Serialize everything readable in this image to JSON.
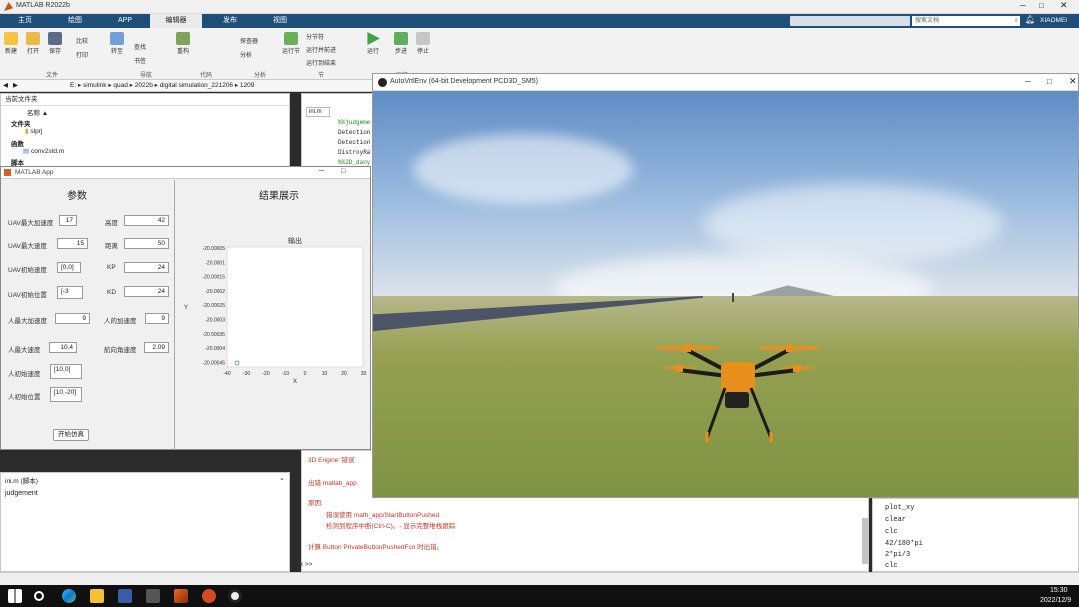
{
  "title": {
    "app": "MATLAB R2022b"
  },
  "tabs": [
    "主页",
    "绘图",
    "APP",
    "编辑器",
    "发布",
    "视图"
  ],
  "search_placeholder": "搜索文档",
  "user": "XIAOMEI",
  "ribbon": {
    "new": "新建",
    "open": "打开",
    "save": "保存",
    "compare": "比较",
    "print": "打印",
    "goto": "转至",
    "find": "查找",
    "bookmark": "书签",
    "refactor": "重构",
    "profiler": "探查器",
    "analyze": "分析",
    "section": "分节符",
    "run_section": "运行节",
    "run_advance": "运行并前进",
    "run_end": "运行到结束",
    "run": "运行",
    "step": "步进",
    "stop": "停止",
    "groups": [
      "文件",
      "导航",
      "代码",
      "分析",
      "节",
      "运行"
    ]
  },
  "address": [
    "E:",
    "simulink",
    "quad",
    "2022b",
    "digital simulation_221206",
    "1209"
  ],
  "current_folder": {
    "title": "当前文件夹",
    "name_col": "名称 ▲",
    "groups": [
      "文件夹",
      "函数",
      "脚本"
    ],
    "items": [
      "slprj",
      "conv2std.m"
    ]
  },
  "editor": {
    "tab": "ini.m",
    "lines": [
      "%%judgeme",
      "Detection",
      "Detection",
      "DistroyRa",
      "%%2D_dany"
    ]
  },
  "matlab_app": {
    "title": "MATLAB App",
    "params_title": "参数",
    "result_title": "结果展示",
    "labels": {
      "uav_max_acc": "UAV最大加速度",
      "uav_max_speed": "UAV最大速度",
      "uav_init_speed": "UAV初始速度",
      "uav_init_pos": "UAV初始位置",
      "person_max_acc": "人最大加速度",
      "person_max_speed": "人最大速度",
      "person_init_speed": "人初始速度",
      "person_init_pos": "人初始位置",
      "height": "高度",
      "distance": "距离",
      "kp": "KP",
      "kd": "KD",
      "person_acc": "人的加速度",
      "heading": "航向角速度"
    },
    "values": {
      "uav_max_acc": "17",
      "uav_max_speed": "15",
      "uav_init_speed": "[0,0]",
      "uav_init_pos": "[-3",
      "person_max_acc": "9",
      "person_max_speed": "10.4",
      "person_init_speed": "[10,0]",
      "person_init_pos": "[10,-20]",
      "height": "42",
      "distance": "50",
      "kp": "24",
      "kd": "24",
      "person_acc": "9",
      "heading": "2.09"
    },
    "start_button": "开始仿真",
    "plot_title": "输出",
    "yticks": [
      "-20.00005",
      "-20.0001",
      "-20.00015",
      "-20.0002",
      "-20.00025",
      "-20.0003",
      "-20.00035",
      "-20.0004",
      "-20.00045"
    ],
    "xticks": [
      "-40",
      "-30",
      "-20",
      "-10",
      "0",
      "10",
      "20",
      "30"
    ],
    "xlabel": "X",
    "ylabel": "Y"
  },
  "script_panel": {
    "title": "ini.m (脚本)",
    "content": "judgement"
  },
  "command_window": {
    "lines": [
      "3D Engine' 错误",
      "出错 matlab_app",
      "原因:",
      "错误使用 math_app/StartButtonPushed",
      "检测到程序中断(Ctrl-C)。- 显示完整堆栈跟踪",
      "计算 Button PrivateButtonPushedFcn 时出错。"
    ],
    "prompt": "fx >>"
  },
  "history": [
    "plot_xy",
    "clear",
    "clc",
    "42/180*pi",
    "2*pi/3",
    "clc"
  ],
  "unreal": {
    "title": "AutoVrtlEnv (64-bit Development PCD3D_SM5)"
  },
  "taskbar": {
    "time": "15:30",
    "date": "2022/12/9"
  },
  "colors": {
    "tabbar": "#1f4e79",
    "ribbon": "#f2f2f2",
    "ground": "#8a9a4a",
    "sky": "#8fb4dc",
    "drone": "#e8901e"
  }
}
